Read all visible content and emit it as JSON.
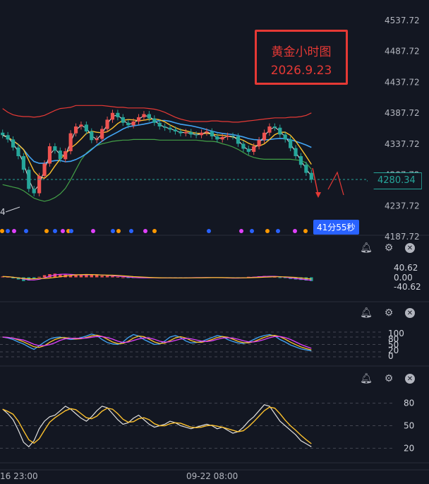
{
  "annotation": {
    "line1": "黄金小时图",
    "line2": "2026.9.23"
  },
  "price_axis": {
    "ticks": [
      "4537.72",
      "4487.72",
      "4437.72",
      "4387.72",
      "4337.72",
      "4287.72",
      "4237.72",
      "4187.72"
    ]
  },
  "last_price": "4280.34",
  "countdown": "41分55秒",
  "left_label_fragment": "4",
  "macd_axis": {
    "ticks": [
      "40.62",
      "0.00",
      "-40.62"
    ]
  },
  "kdj_axis": {
    "ticks": [
      "100",
      "80",
      "50",
      "20",
      "0"
    ]
  },
  "rsi_axis": {
    "ticks": [
      "80",
      "50",
      "20"
    ]
  },
  "time_axis": {
    "labels": [
      "16 23:00",
      "09-22 08:00"
    ]
  },
  "icons": [
    "bell-icon",
    "gear-icon",
    "close-icon"
  ],
  "colors": {
    "bg": "#131722",
    "up": "#ef5350",
    "down": "#26a69a",
    "upper_band": "#e53935",
    "lower_band": "#43a047",
    "ma_yellow": "#fbc02d",
    "ma_blue": "#42a5f5",
    "ma_white": "#e0e0e0",
    "ma_pink": "#e040fb"
  },
  "chart_data": [
    {
      "type": "candlestick",
      "title": "",
      "y_ticks": [
        4537.72,
        4487.72,
        4437.72,
        4387.72,
        4337.72,
        4287.72,
        4237.72,
        4187.72
      ],
      "ylim": [
        4187.72,
        4547.72
      ],
      "close_series": [
        4352,
        4345,
        4332,
        4318,
        4296,
        4265,
        4258,
        4286,
        4306,
        4334,
        4327,
        4313,
        4326,
        4355,
        4366,
        4369,
        4358,
        4344,
        4346,
        4362,
        4377,
        4388,
        4381,
        4372,
        4368,
        4374,
        4381,
        4386,
        4379,
        4372,
        4366,
        4364,
        4361,
        4358,
        4355,
        4357,
        4353,
        4352,
        4356,
        4358,
        4350,
        4345,
        4349,
        4351,
        4350,
        4338,
        4330,
        4325,
        4334,
        4344,
        4356,
        4366,
        4364,
        4353,
        4345,
        4331,
        4318,
        4304,
        4291,
        4280
      ],
      "upper_band": [
        4395,
        4389,
        4385,
        4383,
        4382,
        4382,
        4381,
        4382,
        4384,
        4388,
        4392,
        4395,
        4396,
        4397,
        4400,
        4400,
        4400,
        4400,
        4400,
        4400,
        4399,
        4398,
        4397,
        4397,
        4396,
        4396,
        4396,
        4396,
        4395,
        4394,
        4392,
        4389,
        4385,
        4381,
        4378,
        4376,
        4374,
        4374,
        4374,
        4374,
        4375,
        4375,
        4374,
        4374,
        4373,
        4373,
        4374,
        4375,
        4376,
        4377,
        4378,
        4379,
        4380,
        4380,
        4380,
        4381,
        4381,
        4382,
        4384,
        4388
      ],
      "lower_band": [
        4272,
        4270,
        4268,
        4266,
        4262,
        4256,
        4250,
        4247,
        4245,
        4247,
        4251,
        4257,
        4266,
        4280,
        4296,
        4312,
        4323,
        4330,
        4335,
        4338,
        4340,
        4342,
        4343,
        4344,
        4344,
        4345,
        4345,
        4345,
        4345,
        4345,
        4344,
        4344,
        4344,
        4344,
        4344,
        4344,
        4344,
        4344,
        4343,
        4342,
        4342,
        4341,
        4338,
        4336,
        4333,
        4329,
        4324,
        4319,
        4316,
        4314,
        4313,
        4313,
        4313,
        4313,
        4313,
        4313,
        4312,
        4311,
        4307,
        4297
      ]
    },
    {
      "type": "bar",
      "title": "",
      "series": [
        {
          "name": "",
          "values": [
            3,
            2,
            -4,
            -8,
            -14,
            -12,
            -6,
            2,
            8,
            12,
            14,
            12,
            10,
            8,
            8,
            10,
            11,
            10,
            8,
            6,
            6,
            4,
            2,
            0,
            -2,
            -2,
            -1,
            -1,
            -2,
            -2,
            -3,
            -2,
            -2,
            -3,
            -2,
            -1,
            0,
            -1,
            -1,
            0,
            -1,
            -2,
            -2,
            -3,
            -4,
            -2,
            0,
            2,
            2,
            4,
            5,
            4,
            2,
            -1,
            -3,
            -6,
            -8,
            -10,
            -12,
            -14
          ]
        }
      ],
      "ylim": [
        -60,
        60
      ]
    },
    {
      "type": "line",
      "title": "",
      "series": [
        {
          "name": "",
          "values": [
            80,
            76,
            70,
            60,
            52,
            40,
            30,
            45,
            60,
            72,
            78,
            80,
            74,
            70,
            72,
            78,
            84,
            92,
            86,
            70,
            58,
            52,
            50,
            60,
            78,
            90,
            84,
            70,
            60,
            50,
            52,
            64,
            80,
            86,
            78,
            64,
            56,
            58,
            62,
            70,
            78,
            86,
            82,
            70,
            62,
            56,
            54,
            60,
            70,
            80,
            86,
            90,
            84,
            70,
            60,
            48,
            40,
            32,
            28,
            24
          ]
        }
      ],
      "ylim": [
        0,
        100
      ]
    },
    {
      "type": "line",
      "title": "",
      "series": [
        {
          "name": "",
          "values": [
            72,
            66,
            58,
            44,
            28,
            22,
            30,
            46,
            56,
            62,
            64,
            70,
            76,
            72,
            66,
            60,
            56,
            62,
            70,
            76,
            74,
            66,
            58,
            52,
            54,
            60,
            64,
            58,
            52,
            48,
            50,
            52,
            56,
            54,
            50,
            48,
            46,
            48,
            50,
            52,
            50,
            46,
            48,
            44,
            40,
            42,
            48,
            56,
            62,
            70,
            78,
            76,
            66,
            56,
            50,
            44,
            38,
            30,
            26,
            22
          ]
        }
      ],
      "ylim": [
        10,
        90
      ]
    }
  ]
}
